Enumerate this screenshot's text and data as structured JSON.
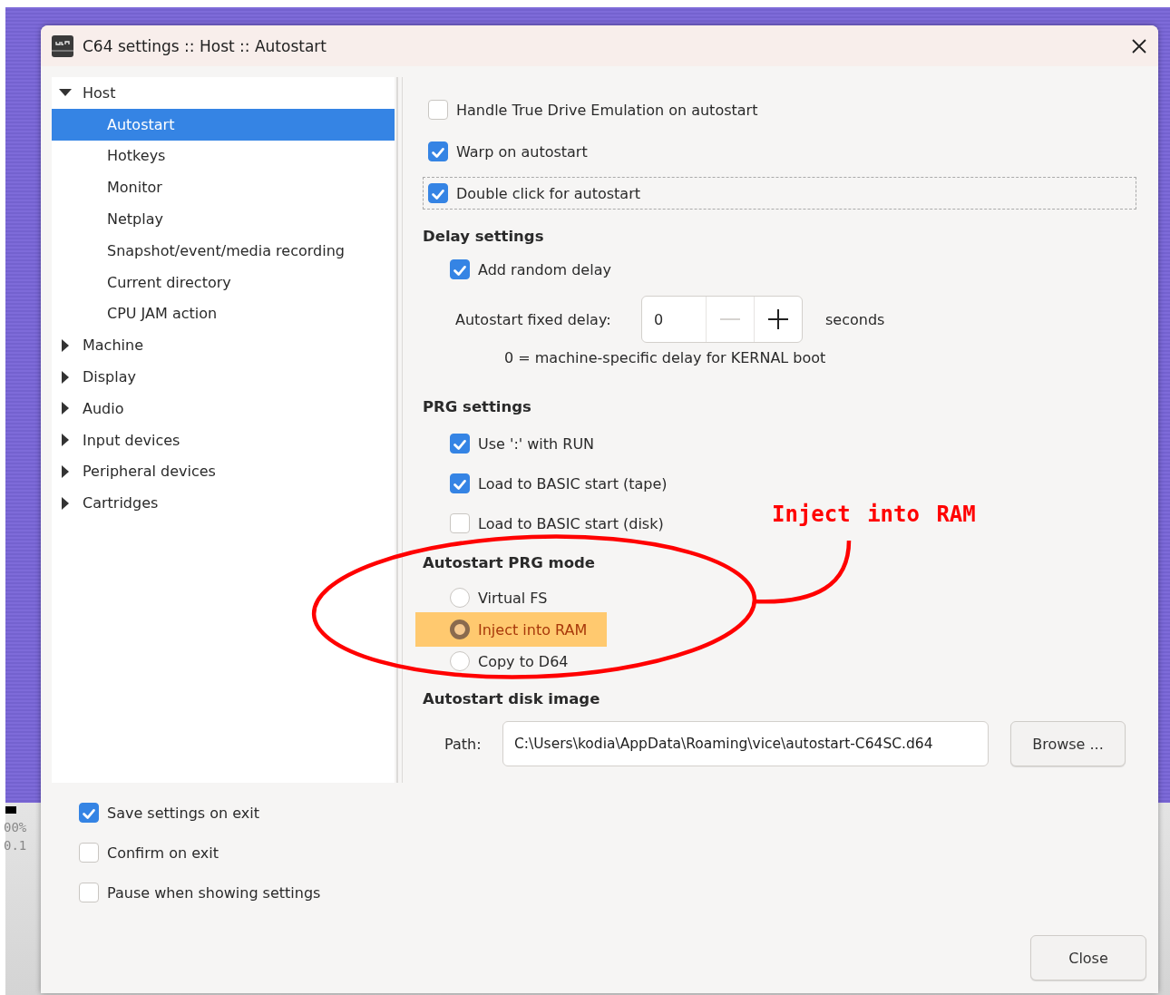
{
  "window": {
    "title": "C64 settings :: Host :: Autostart"
  },
  "tree": [
    {
      "label": "Host",
      "expanded": true,
      "selected": false,
      "children": [
        {
          "label": "Autostart",
          "selected": true
        },
        {
          "label": "Hotkeys",
          "selected": false
        },
        {
          "label": "Monitor",
          "selected": false
        },
        {
          "label": "Netplay",
          "selected": false
        },
        {
          "label": "Snapshot/event/media recording",
          "selected": false
        },
        {
          "label": "Current directory",
          "selected": false
        },
        {
          "label": "CPU JAM action",
          "selected": false
        }
      ]
    },
    {
      "label": "Machine",
      "expanded": false,
      "selected": false
    },
    {
      "label": "Display",
      "expanded": false,
      "selected": false
    },
    {
      "label": "Audio",
      "expanded": false,
      "selected": false
    },
    {
      "label": "Input devices",
      "expanded": false,
      "selected": false
    },
    {
      "label": "Peripheral devices",
      "expanded": false,
      "selected": false
    },
    {
      "label": "Cartridges",
      "expanded": false,
      "selected": false
    }
  ],
  "options": [
    {
      "label": "Handle True Drive Emulation on autostart",
      "checked": false,
      "focused": false
    },
    {
      "label": "Warp on autostart",
      "checked": true,
      "focused": false
    },
    {
      "label": "Double click for autostart",
      "checked": true,
      "focused": true
    }
  ],
  "delay_settings": {
    "heading": "Delay settings",
    "random_delay": {
      "label": "Add random delay",
      "checked": true
    },
    "fixed_delay": {
      "label": "Autostart fixed delay:",
      "value": "0",
      "decrement_disabled": true,
      "unit": "seconds",
      "hint": "0 = machine-specific delay for KERNAL boot"
    }
  },
  "prg_settings": {
    "heading": "PRG settings",
    "options": [
      {
        "label": "Use ':' with RUN",
        "checked": true
      },
      {
        "label": "Load to BASIC start (tape)",
        "checked": true
      },
      {
        "label": "Load to BASIC start (disk)",
        "checked": false
      }
    ]
  },
  "prg_mode": {
    "heading": "Autostart PRG mode",
    "options": [
      {
        "label": "Virtual FS",
        "selected": false,
        "highlighted": false
      },
      {
        "label": "Inject into RAM",
        "selected": true,
        "highlighted": true
      },
      {
        "label": "Copy to D64",
        "selected": false,
        "highlighted": false
      }
    ]
  },
  "disk_image": {
    "heading": "Autostart disk image",
    "path_label": "Path:",
    "path": "C:\\Users\\kodia\\AppData\\Roaming\\vice\\autostart-C64SC.d64",
    "browse": "Browse ..."
  },
  "footer": {
    "options": [
      {
        "label": "Save settings on exit",
        "checked": true
      },
      {
        "label": "Confirm on exit",
        "checked": false
      },
      {
        "label": "Pause when showing settings",
        "checked": false
      }
    ],
    "close": "Close"
  },
  "annotation": {
    "text": "Inject into RAM"
  },
  "background_window": {
    "lines": [
      "00%",
      "0.1"
    ]
  }
}
